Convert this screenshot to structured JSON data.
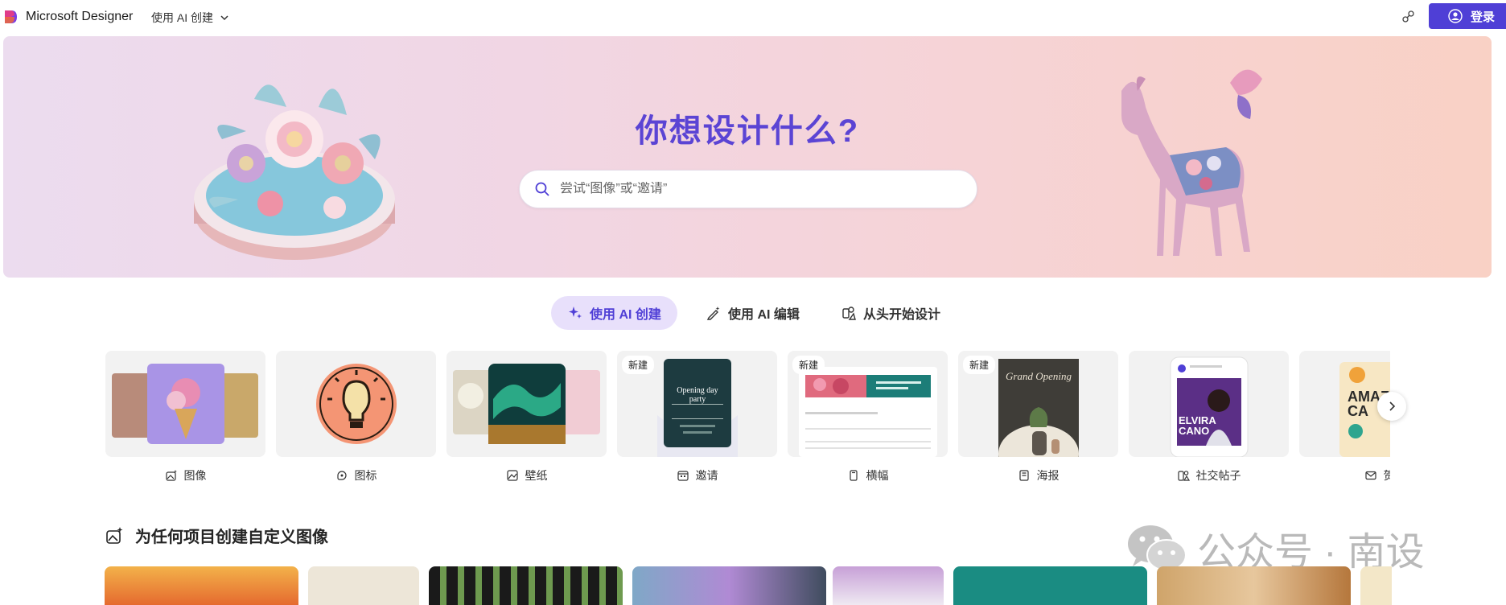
{
  "header": {
    "brand": "Microsoft Designer",
    "mode_label": "使用 AI 创建",
    "login_label": "登录"
  },
  "hero": {
    "title": "你想设计什么?",
    "search_placeholder": "尝试“图像”或“邀请”"
  },
  "tabs": [
    {
      "label": "使用 AI 创建",
      "active": true
    },
    {
      "label": "使用 AI 编辑",
      "active": false
    },
    {
      "label": "从头开始设计",
      "active": false
    }
  ],
  "cards": [
    {
      "label": "图像",
      "icon": "image-sparkle-icon",
      "new": false
    },
    {
      "label": "图标",
      "icon": "sticker-icon",
      "new": false
    },
    {
      "label": "壁纸",
      "icon": "wallpaper-icon",
      "new": false
    },
    {
      "label": "邀请",
      "icon": "calendar-icon",
      "new": true,
      "badge": "新建",
      "thumb_text": "Opening day party"
    },
    {
      "label": "横幅",
      "icon": "banner-icon",
      "new": true,
      "badge": "新建"
    },
    {
      "label": "海报",
      "icon": "poster-icon",
      "new": true,
      "badge": "新建",
      "thumb_text": "Grand Opening"
    },
    {
      "label": "社交帖子",
      "icon": "social-post-icon",
      "new": false,
      "thumb_text": "ELVIRA CANO"
    },
    {
      "label": "贺",
      "icon": "mail-icon",
      "new": false,
      "thumb_text": "AMAZING CA"
    }
  ],
  "section": {
    "title": "为任何项目创建自定义图像"
  },
  "watermark": {
    "text": "公众号 · 南设"
  },
  "colors": {
    "accent": "#4f3fd6",
    "hero_title": "#5b44d4",
    "tab_active_bg": "#e8e0fb"
  }
}
